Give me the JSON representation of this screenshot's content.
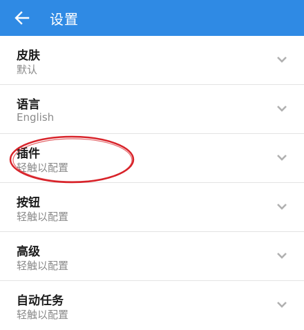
{
  "header": {
    "title": "设置",
    "back_icon": "arrow-left-icon",
    "background": "#2f8ae4"
  },
  "settings": {
    "items": [
      {
        "label": "皮肤",
        "value": "默认"
      },
      {
        "label": "语言",
        "value": "English"
      },
      {
        "label": "插件",
        "value": "轻触以配置"
      },
      {
        "label": "按钮",
        "value": "轻触以配置"
      },
      {
        "label": "高级",
        "value": "轻触以配置"
      },
      {
        "label": "自动任务",
        "value": "轻触以配置"
      }
    ],
    "chevron_icon": "chevron-down-icon"
  },
  "annotation": {
    "shape": "ellipse-highlight",
    "color": "#d8232a",
    "target": "插件"
  }
}
